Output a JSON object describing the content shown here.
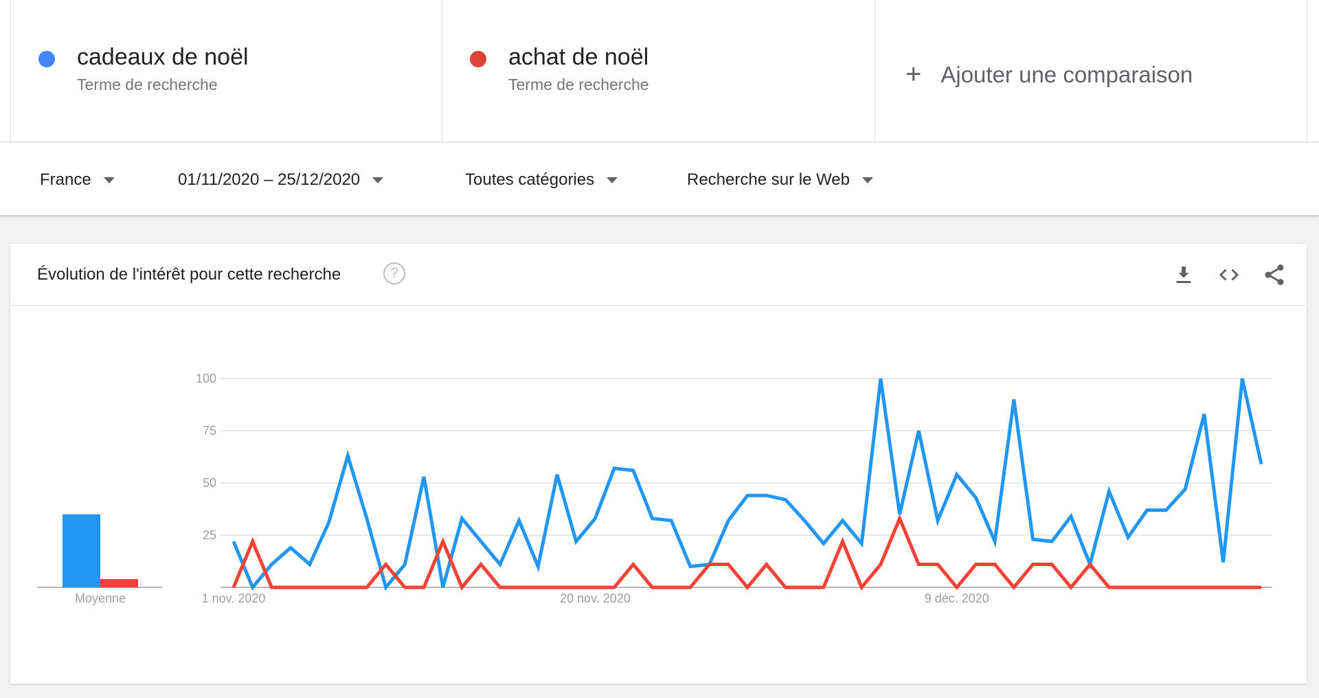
{
  "terms": [
    {
      "name": "cadeaux de noël",
      "subtitle": "Terme de recherche",
      "color": "#4285f4"
    },
    {
      "name": "achat de noël",
      "subtitle": "Terme de recherche",
      "color": "#db4437"
    }
  ],
  "add_comparison": {
    "icon": "plus-icon",
    "label": "Ajouter une comparaison"
  },
  "filters": {
    "region": "France",
    "dates": "01/11/2020 – 25/12/2020",
    "category": "Toutes catégories",
    "search_type": "Recherche sur le Web"
  },
  "card": {
    "title": "Évolution de l'intérêt pour cette recherche",
    "help": "?",
    "icons": [
      "download-icon",
      "embed-code-icon",
      "share-icon"
    ]
  },
  "chart_data": {
    "type": "line",
    "title": "",
    "ylim": [
      0,
      100
    ],
    "yticks": [
      100,
      75,
      50,
      25
    ],
    "x_start": "2020-11-01",
    "x_end": "2020-12-25",
    "xtick_labels": [
      {
        "label": "1 nov. 2020",
        "date": "2020-11-01"
      },
      {
        "label": "20 nov. 2020",
        "date": "2020-11-20"
      },
      {
        "label": "9 déc. 2020",
        "date": "2020-12-09"
      }
    ],
    "grid": true,
    "series": [
      {
        "name": "cadeaux de noël",
        "color": "#2196f3",
        "values": [
          22,
          0,
          11,
          19,
          11,
          31,
          63,
          33,
          0,
          11,
          53,
          0,
          33,
          22,
          11,
          32,
          10,
          54,
          22,
          33,
          57,
          56,
          33,
          32,
          10,
          11,
          32,
          44,
          44,
          42,
          32,
          21,
          32,
          21,
          100,
          35,
          75,
          32,
          54,
          43,
          22,
          90,
          23,
          22,
          34,
          11,
          46,
          24,
          37,
          37,
          47,
          83,
          12,
          100,
          59
        ]
      },
      {
        "name": "achat de noël",
        "color": "#f44336",
        "values": [
          0,
          22,
          0,
          0,
          0,
          0,
          0,
          0,
          11,
          0,
          0,
          22,
          0,
          11,
          0,
          0,
          0,
          0,
          0,
          0,
          0,
          11,
          0,
          0,
          0,
          11,
          11,
          0,
          11,
          0,
          0,
          0,
          22,
          0,
          11,
          33,
          11,
          11,
          0,
          11,
          11,
          0,
          11,
          11,
          0,
          11,
          0,
          0,
          0,
          0,
          0,
          0,
          0,
          0,
          0
        ]
      }
    ],
    "average": {
      "label": "Moyenne",
      "values": [
        35,
        4
      ]
    }
  }
}
